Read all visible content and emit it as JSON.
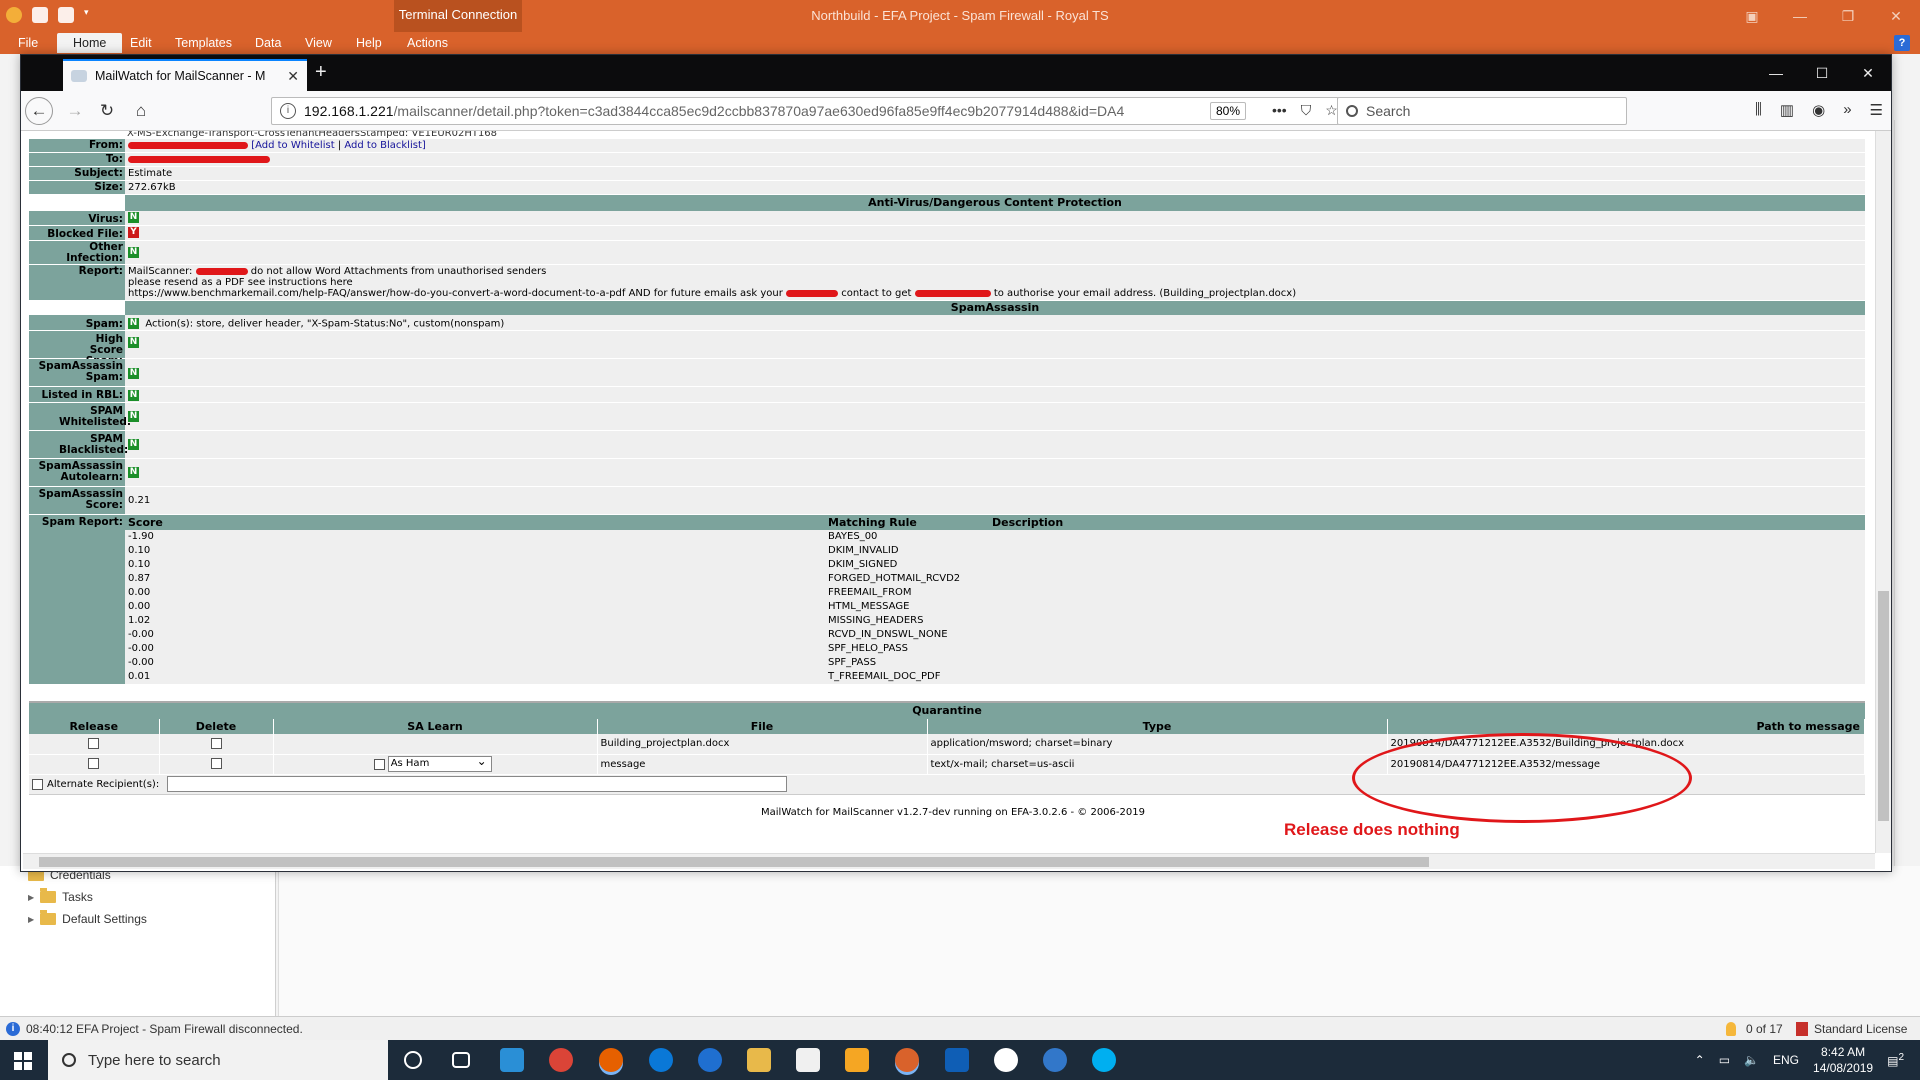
{
  "royalts": {
    "contextual_tab": "Terminal Connection",
    "title": "Northbuild - EFA Project - Spam Firewall - Royal TS",
    "menu": [
      "File",
      "Home",
      "Edit",
      "Templates",
      "Data",
      "View",
      "Help",
      "Actions"
    ],
    "active_menu": "Home",
    "help": "?",
    "nav_items": [
      "Credentials",
      "Tasks",
      "Default Settings"
    ],
    "status_message": "08:40:12 EFA Project - Spam Firewall disconnected.",
    "status_count": "0 of 17",
    "license": "Standard License"
  },
  "firefox": {
    "tab_title": "MailWatch for MailScanner - M",
    "url_host": "192.168.1.221",
    "url_path": "/mailscanner/detail.php?token=c3ad3844cca85ec9d2ccbb837870a97ae630ed96fa85e9ff4ec9b2077914d488&id=DA4",
    "zoom": "80%",
    "search_placeholder": "Search"
  },
  "message": {
    "header_overflow": "X-MS-Exchange-Transport-CrossTenantHeadersStamped: VE1EUR02HT168",
    "labels": {
      "from": "From:",
      "to": "To:",
      "subject": "Subject:",
      "size": "Size:",
      "virus": "Virus:",
      "blocked": "Blocked File:",
      "other_infection": "Other Infection:",
      "report": "Report:",
      "spam": "Spam:",
      "high_score": "High Score Spam:",
      "sa_spam": "SpamAssassin Spam:",
      "rbl": "Listed in RBL:",
      "whitelisted": "SPAM Whitelisted:",
      "blacklisted": "SPAM Blacklisted:",
      "autolearn": "SpamAssassin Autolearn:",
      "sa_score": "SpamAssassin Score:",
      "spam_report": "Spam Report:"
    },
    "add_whitelist": "[Add to Whitelist",
    "add_blacklist": "Add to Blacklist]",
    "subject": "Estimate",
    "size": "272.67kB",
    "av_section": "Anti-Virus/Dangerous Content Protection",
    "virus": "N",
    "blocked_file": "Y",
    "other_infection": "N",
    "report_line1_a": "MailScanner: ",
    "report_line1_b": " do not allow Word Attachments from unauthorised senders",
    "report_line2": "please resend as a PDF see instructions here",
    "report_line3_a": "https://www.benchmarkemail.com/help-FAQ/answer/how-do-you-convert-a-word-document-to-a-pdf AND for future emails ask your",
    "report_line3_b": "contact to get",
    "report_line3_c": "to authorise your email address. (Building_projectplan.docx)",
    "sa_section": "SpamAssassin",
    "spam": "N",
    "spam_actions": "Action(s): store, deliver header, \"X-Spam-Status:No\", custom(nonspam)",
    "high_score": "N",
    "sa_spam": "N",
    "rbl": "N",
    "whitelisted": "N",
    "blacklisted": "N",
    "autolearn": "N",
    "sa_score": "0.21",
    "spam_report_headers": [
      "Score",
      "Matching Rule",
      "Description"
    ],
    "spam_report_rows": [
      [
        "-1.90",
        "BAYES_00",
        ""
      ],
      [
        "0.10",
        "DKIM_INVALID",
        ""
      ],
      [
        "0.10",
        "DKIM_SIGNED",
        ""
      ],
      [
        "0.87",
        "FORGED_HOTMAIL_RCVD2",
        ""
      ],
      [
        "0.00",
        "FREEMAIL_FROM",
        ""
      ],
      [
        "0.00",
        "HTML_MESSAGE",
        ""
      ],
      [
        "1.02",
        "MISSING_HEADERS",
        ""
      ],
      [
        "-0.00",
        "RCVD_IN_DNSWL_NONE",
        ""
      ],
      [
        "-0.00",
        "SPF_HELO_PASS",
        ""
      ],
      [
        "-0.00",
        "SPF_PASS",
        ""
      ],
      [
        "0.01",
        "T_FREEMAIL_DOC_PDF",
        ""
      ]
    ]
  },
  "quarantine": {
    "title": "Quarantine",
    "headers": [
      "Release",
      "Delete",
      "SA Learn",
      "File",
      "Type",
      "Path to message"
    ],
    "rows": [
      {
        "file": "Building_projectplan.docx",
        "type": "application/msword; charset=binary",
        "path": "20190814/DA4771212EE.A3532/Building_projectplan.docx"
      },
      {
        "file": "message",
        "type": "text/x-mail; charset=us-ascii",
        "path": "20190814/DA4771212EE.A3532/message"
      }
    ],
    "sa_learn_option": "As Ham",
    "alt_recipient_label": "Alternate Recipient(s):"
  },
  "footer": "MailWatch for MailScanner v1.2.7-dev running on EFA-3.0.2.6 - © 2006-2019",
  "annotation": "Release does nothing",
  "taskbar": {
    "search_placeholder": "Type here to search",
    "lang": "ENG",
    "time": "8:42 AM",
    "date": "14/08/2019",
    "notif_count": "2"
  },
  "colors": {
    "royalts_orange": "#d9622b",
    "mailwatch_teal": "#7ca39c",
    "annotation_red": "#e0171a",
    "flag_green": "#1c8f2a",
    "flag_red": "#cc1a1a"
  }
}
